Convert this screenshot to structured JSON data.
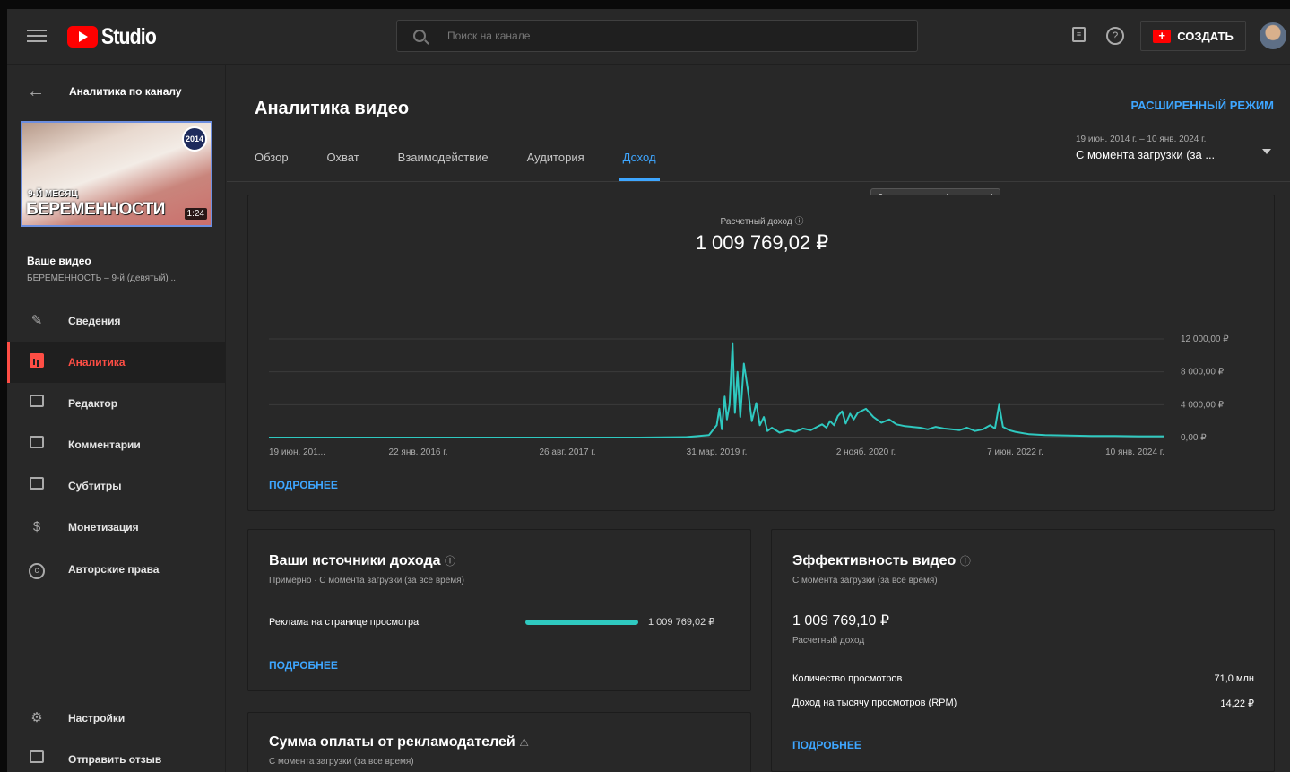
{
  "header": {
    "app_name": "Studio",
    "search_placeholder": "Поиск на канале",
    "create_label": "СОЗДАТЬ"
  },
  "sidebar": {
    "back_title": "Аналитика по каналу",
    "thumbnail": {
      "line1": "9-Й МЕСЯЦ",
      "line2": "БЕРЕМЕННОСТИ",
      "duration": "1:24",
      "channel_badge": "2014"
    },
    "your_video_label": "Ваше видео",
    "video_title": "БЕРЕМЕННОСТЬ – 9-й (девятый) ...",
    "items": [
      {
        "label": "Сведения",
        "icon": "pencil-icon"
      },
      {
        "label": "Аналитика",
        "icon": "analytics-icon"
      },
      {
        "label": "Редактор",
        "icon": "editor-icon"
      },
      {
        "label": "Комментарии",
        "icon": "comments-icon"
      },
      {
        "label": "Субтитры",
        "icon": "subtitles-icon"
      },
      {
        "label": "Монетизация",
        "icon": "dollar-icon"
      },
      {
        "label": "Авторские права",
        "icon": "copyright-icon"
      }
    ],
    "bottom_items": [
      {
        "label": "Настройки",
        "icon": "gear-icon"
      },
      {
        "label": "Отправить отзыв",
        "icon": "feedback-icon"
      }
    ]
  },
  "main": {
    "title": "Аналитика видео",
    "advanced_mode": "РАСШИРЕННЫЙ РЕЖИМ",
    "tabs": [
      "Обзор",
      "Охват",
      "Взаимодействие",
      "Аудитория",
      "Доход"
    ],
    "active_tab": "Доход",
    "date_range": {
      "dates": "19 июн. 2014 г. – 10 янв. 2024 г.",
      "label": "С момента загрузки (за ..."
    },
    "tooltip": "С момента загрузки (за все время)",
    "revenue_card": {
      "metric_label": "Расчетный доход",
      "metric_value": "1 009 769,02 ₽",
      "more": "ПОДРОБНЕЕ"
    },
    "sources_card": {
      "title": "Ваши источники дохода",
      "subtitle": "Примерно · С момента загрузки (за все время)",
      "source_label": "Реклама на странице просмотра",
      "source_value": "1 009 769,02 ₽",
      "source_share": 1.0,
      "more": "ПОДРОБНЕЕ"
    },
    "performance_card": {
      "title": "Эффективность видео",
      "subtitle": "С момента загрузки (за все время)",
      "value": "1 009 769,10 ₽",
      "value_label": "Расчетный доход",
      "rows": [
        {
          "label": "Количество просмотров",
          "value": "71,0 млн"
        },
        {
          "label": "Доход на тысячу просмотров (RPM)",
          "value": "14,22 ₽"
        }
      ],
      "more": "ПОДРОБНЕЕ"
    },
    "advertiser_card": {
      "title": "Сумма оплаты от рекламодателей",
      "subtitle": "С момента загрузки (за все время)"
    }
  },
  "colors": {
    "accent": "#3ea6ff",
    "active_nav": "#ff4e45",
    "series": "#2fc9c0",
    "brand": "#ff0000"
  },
  "chart_data": {
    "type": "line",
    "title": "Расчетный доход",
    "x_tick_labels": [
      "19 июн. 201...",
      "22 янв. 2016 г.",
      "26 авг. 2017 г.",
      "31 мар. 2019 г.",
      "2 нояб. 2020 г.",
      "7 июн. 2022 г.",
      "10 янв. 2024 г."
    ],
    "y_tick_labels": [
      "0,00 ₽",
      "4 000,00 ₽",
      "8 000,00 ₽",
      "12 000,00 ₽"
    ],
    "ylim": [
      0,
      12000
    ],
    "y_ticks": [
      0,
      4000,
      8000,
      12000
    ],
    "y_axis_side": "right",
    "grid": true,
    "series": [
      {
        "x": [
          "2014-06-19",
          "2015-01-01",
          "2016-01-22",
          "2017-08-26",
          "2018-06-01",
          "2018-12-01",
          "2019-03-01",
          "2019-03-31",
          "2019-04-10",
          "2019-04-20",
          "2019-05-01",
          "2019-05-10",
          "2019-05-20",
          "2019-06-01",
          "2019-06-10",
          "2019-06-20",
          "2019-07-01",
          "2019-07-15",
          "2019-08-01",
          "2019-08-15",
          "2019-09-01",
          "2019-09-15",
          "2019-10-01",
          "2019-10-15",
          "2019-11-01",
          "2019-12-01",
          "2020-01-01",
          "2020-02-01",
          "2020-03-01",
          "2020-04-01",
          "2020-05-01",
          "2020-05-15",
          "2020-06-01",
          "2020-06-15",
          "2020-07-01",
          "2020-07-15",
          "2020-08-01",
          "2020-08-15",
          "2020-09-01",
          "2020-09-15",
          "2020-10-01",
          "2020-11-02",
          "2020-12-01",
          "2021-01-01",
          "2021-02-01",
          "2021-03-01",
          "2021-04-01",
          "2021-05-01",
          "2021-06-01",
          "2021-07-01",
          "2021-08-01",
          "2021-09-01",
          "2021-10-01",
          "2021-11-01",
          "2021-12-01",
          "2022-01-01",
          "2022-02-01",
          "2022-03-01",
          "2022-03-20",
          "2022-04-05",
          "2022-04-20",
          "2022-05-15",
          "2022-06-07",
          "2022-08-01",
          "2022-10-01",
          "2023-01-01",
          "2023-04-01",
          "2023-07-01",
          "2023-10-01",
          "2024-01-10"
        ],
        "y": [
          0,
          0,
          0,
          0,
          0,
          50,
          300,
          1500,
          3500,
          1000,
          5000,
          2200,
          4000,
          11500,
          3000,
          8000,
          2500,
          9000,
          5500,
          2000,
          4200,
          1500,
          2500,
          800,
          1200,
          600,
          900,
          700,
          1100,
          900,
          1400,
          1600,
          1200,
          2000,
          1500,
          2600,
          3200,
          1700,
          2900,
          2200,
          3000,
          3500,
          2500,
          1800,
          2200,
          1600,
          1400,
          1300,
          1200,
          1000,
          1300,
          1100,
          1000,
          900,
          1200,
          800,
          1000,
          1500,
          1100,
          4000,
          1300,
          900,
          700,
          400,
          300,
          250,
          200,
          200,
          150,
          150
        ]
      }
    ]
  }
}
